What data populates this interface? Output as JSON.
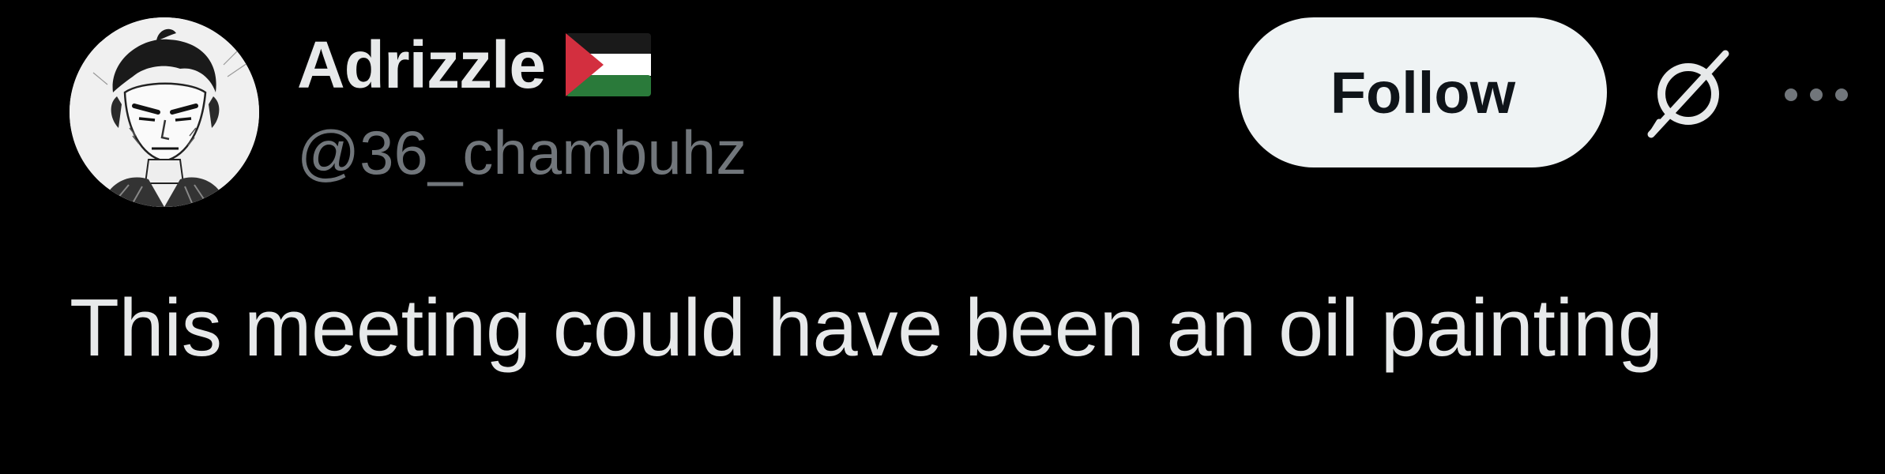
{
  "tweet": {
    "author": {
      "display_name": "Adrizzle",
      "handle": "@36_chambuhz",
      "avatar_icon": "manga-portrait-avatar",
      "name_emoji": "palestine-flag-icon"
    },
    "actions": {
      "follow_label": "Follow",
      "grok_icon": "grok-icon",
      "more_icon": "more-options-icon"
    },
    "text": "This meeting could have been an oil painting"
  },
  "colors": {
    "background": "#000000",
    "primary_text": "#e7e9ea",
    "secondary_text": "#71767b",
    "follow_bg": "#eff3f4",
    "follow_text": "#0f1419",
    "flag_black": "#1a1a1a",
    "flag_white": "#ffffff",
    "flag_green": "#2a7a3a",
    "flag_red": "#d32f3f"
  }
}
